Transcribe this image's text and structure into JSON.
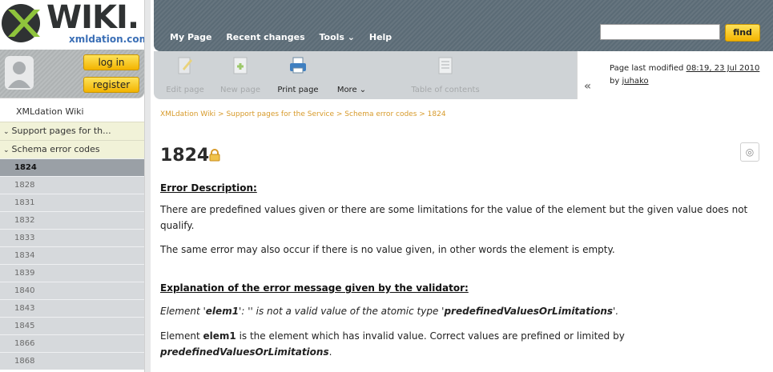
{
  "logo": {
    "title": "WIKI.",
    "subtitle": "xmldation.com"
  },
  "user": {
    "login_label": "log in",
    "register_label": "register"
  },
  "sidebar": {
    "root": "XMLdation Wiki",
    "sections": [
      "Support pages for th...",
      "Schema error codes"
    ],
    "items": [
      "1824",
      "1828",
      "1831",
      "1832",
      "1833",
      "1834",
      "1839",
      "1840",
      "1843",
      "1845",
      "1866",
      "1868"
    ],
    "active": "1824"
  },
  "topnav": {
    "items": [
      "My Page",
      "Recent changes",
      "Tools ⌄",
      "Help"
    ],
    "find_label": "find",
    "search_value": ""
  },
  "toolbar": {
    "items": [
      "Edit page",
      "New page",
      "Print page",
      "More ⌄",
      "Table of contents"
    ]
  },
  "modified": {
    "line1": "Page last modified",
    "date": "08:19, 23 Jul 2010",
    "by": "by",
    "author": "juhako"
  },
  "breadcrumb": "XMLdation Wiki > Support pages for the Service > Schema error codes > 1824",
  "page": {
    "title": "1824",
    "section1_title": "Error Description:",
    "para1": "There are predefined values given or there are some limitations for the value of the element but the given value does not qualify.",
    "para2": "The same error may also occur if there is no value given, in other words the element is empty.",
    "section2_title": "Explanation of the error message given by the validator:",
    "msg_pre": "Element '",
    "msg_elem": "elem1",
    "msg_mid": "': '' is not a valid value of the atomic type '",
    "msg_type": "predefinedValuesOrLimitations",
    "msg_end": "'.",
    "para3_pre": "Element ",
    "para3_elem": "elem1",
    "para3_mid": " is the element which has invalid value. Correct values are prefined or limited by",
    "para3_type": "predefinedValuesOrLimitations",
    "para3_end": "."
  }
}
